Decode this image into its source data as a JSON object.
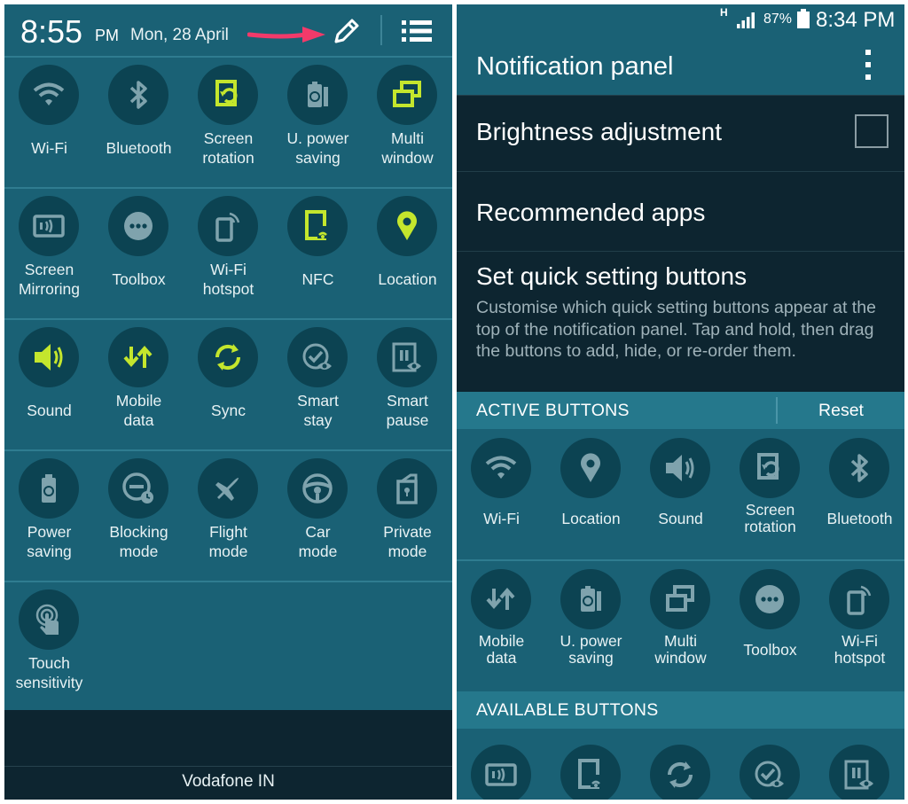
{
  "colors": {
    "panel_bg": "#1a6175",
    "icon_circle": "#0c4352",
    "icon_active": "#c4e62d",
    "icon_inactive": "#7fa3ad",
    "dark_bg": "#0d2530",
    "section_bg": "#25788c",
    "arrow": "#f23a6a"
  },
  "left": {
    "status": {
      "time": "8:55",
      "ampm": "PM",
      "date": "Mon, 28 April"
    },
    "tiles": [
      [
        {
          "label": "Wi-Fi",
          "icon": "wifi-icon",
          "active": false
        },
        {
          "label": "Bluetooth",
          "icon": "bluetooth-icon",
          "active": false
        },
        {
          "label": "Screen rotation",
          "icon": "screen-rotation-icon",
          "active": true
        },
        {
          "label": "U. power saving",
          "icon": "ultra-power-saving-icon",
          "active": false
        },
        {
          "label": "Multi window",
          "icon": "multi-window-icon",
          "active": true
        }
      ],
      [
        {
          "label": "Screen Mirroring",
          "icon": "screen-mirroring-icon",
          "active": false
        },
        {
          "label": "Toolbox",
          "icon": "toolbox-icon",
          "active": false
        },
        {
          "label": "Wi-Fi hotspot",
          "icon": "wifi-hotspot-icon",
          "active": false
        },
        {
          "label": "NFC",
          "icon": "nfc-icon",
          "active": true
        },
        {
          "label": "Location",
          "icon": "location-icon",
          "active": true
        }
      ],
      [
        {
          "label": "Sound",
          "icon": "sound-icon",
          "active": true
        },
        {
          "label": "Mobile data",
          "icon": "mobile-data-icon",
          "active": true
        },
        {
          "label": "Sync",
          "icon": "sync-icon",
          "active": true
        },
        {
          "label": "Smart stay",
          "icon": "smart-stay-icon",
          "active": false
        },
        {
          "label": "Smart pause",
          "icon": "smart-pause-icon",
          "active": false
        }
      ],
      [
        {
          "label": "Power saving",
          "icon": "power-saving-icon",
          "active": false
        },
        {
          "label": "Blocking mode",
          "icon": "blocking-mode-icon",
          "active": false
        },
        {
          "label": "Flight mode",
          "icon": "flight-mode-icon",
          "active": false
        },
        {
          "label": "Car mode",
          "icon": "car-mode-icon",
          "active": false
        },
        {
          "label": "Private mode",
          "icon": "private-mode-icon",
          "active": false
        }
      ],
      [
        {
          "label": "Touch sensitivity",
          "icon": "touch-sensitivity-icon",
          "active": false
        }
      ]
    ],
    "carrier": "Vodafone IN"
  },
  "right": {
    "status": {
      "network": "H",
      "battery": "87%",
      "time": "8:34 PM"
    },
    "title": "Notification panel",
    "items": {
      "brightness": "Brightness adjustment",
      "recommended": "Recommended apps",
      "quick_title": "Set quick setting buttons",
      "quick_desc": "Customise which quick setting buttons appear at the top of the notification panel. Tap and hold, then drag the buttons to add, hide, or re-order them."
    },
    "active_header": "ACTIVE BUTTONS",
    "reset": "Reset",
    "active_tiles": [
      [
        {
          "label": "Wi-Fi",
          "icon": "wifi-icon"
        },
        {
          "label": "Location",
          "icon": "location-icon"
        },
        {
          "label": "Sound",
          "icon": "sound-icon"
        },
        {
          "label": "Screen rotation",
          "icon": "screen-rotation-icon"
        },
        {
          "label": "Bluetooth",
          "icon": "bluetooth-icon"
        }
      ],
      [
        {
          "label": "Mobile data",
          "icon": "mobile-data-icon"
        },
        {
          "label": "U. power saving",
          "icon": "ultra-power-saving-icon"
        },
        {
          "label": "Multi window",
          "icon": "multi-window-icon"
        },
        {
          "label": "Toolbox",
          "icon": "toolbox-icon"
        },
        {
          "label": "Wi-Fi hotspot",
          "icon": "wifi-hotspot-icon"
        }
      ]
    ],
    "available_header": "AVAILABLE BUTTONS",
    "available_tiles": [
      {
        "icon": "screen-mirroring-icon"
      },
      {
        "icon": "nfc-icon"
      },
      {
        "icon": "sync-icon"
      },
      {
        "icon": "smart-stay-icon"
      },
      {
        "icon": "smart-pause-icon"
      }
    ]
  }
}
